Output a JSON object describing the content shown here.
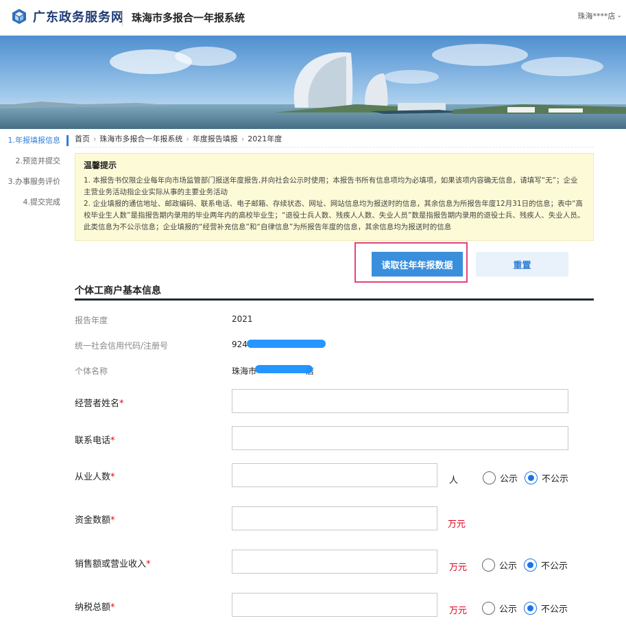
{
  "header": {
    "site_name": "广东政务服务网",
    "system_title": "珠海市多报合一年报系统",
    "user_name": "珠海****店",
    "user_menu_icon": "chevron-down-icon"
  },
  "steps": [
    {
      "label": "1.年报填报信息",
      "active": true
    },
    {
      "label": "2.预览并提交",
      "active": false
    },
    {
      "label": "3.办事服务评价",
      "active": false
    },
    {
      "label": "4.提交完成",
      "active": false
    }
  ],
  "breadcrumb": [
    "首页",
    "珠海市多报合一年报系统",
    "年度报告填报",
    "2021年度"
  ],
  "tip": {
    "title": "温馨提示",
    "line1": "1. 本报告书仅限企业每年向市场监管部门报送年度报告,并向社会公示时使用；本报告书所有信息项均为必填项，如果该项内容确无信息，请填写“无”；企业主营业务活动指企业实际从事的主要业务活动",
    "line2": "2. 企业填报的通信地址、邮政编码、联系电话、电子邮箱、存续状态、网址、网站信息均为报送时的信息，其余信息为所报告年度12月31日的信息；表中“高校毕业生人数”是指报告期内录用的毕业两年内的高校毕业生；“退役士兵人数、残疾人人数、失业人员”数是指报告期内录用的退役士兵、残疾人、失业人员。此类信息为不公示信息；企业填报的“经营补充信息”和“自律信息”为所报告年度的信息，其余信息均为报送时的信息"
  },
  "actions": {
    "read_previous": "读取往年年报数据",
    "reset": "重置"
  },
  "section": {
    "title": "个体工商户基本信息"
  },
  "info": {
    "report_year_label": "报告年度",
    "report_year_value": "2021",
    "credit_code_label": "统一社会信用代码/注册号",
    "credit_code_value": "924",
    "name_label": "个体名称",
    "name_value_prefix": "珠海市",
    "name_value_suffix": "店"
  },
  "form": {
    "operator_name_label": "经营者姓名",
    "phone_label": "联系电话",
    "employees_label": "从业人数",
    "employees_unit": "人",
    "capital_label": "资金数额",
    "capital_unit": "万元",
    "sales_label": "销售额或营业收入",
    "sales_unit": "万元",
    "tax_label": "纳税总额",
    "tax_unit": "万元",
    "required_mark": "*",
    "public_label": "公示",
    "private_label": "不公示",
    "employees_visibility": "不公示",
    "sales_visibility": "不公示",
    "tax_visibility": "不公示"
  },
  "colors": {
    "primary": "#3a8fdc",
    "highlight_border": "#e4427b",
    "tip_background": "#fdfbd7",
    "required": "#e60012",
    "unit_red": "#d9001b"
  }
}
